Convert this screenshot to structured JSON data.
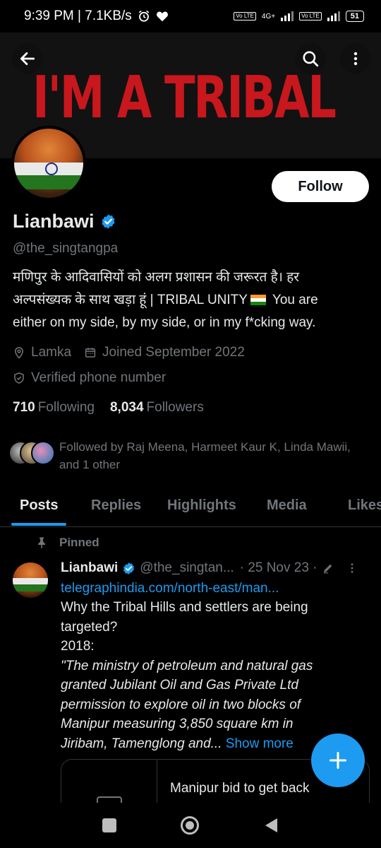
{
  "status_bar": {
    "time_speed": "9:39 PM | 7.1KB/s",
    "network_label": "4G+",
    "volte_label": "Vo LTE",
    "battery": "51"
  },
  "banner": {
    "text": "I'M A TRIBAL"
  },
  "profile": {
    "follow_label": "Follow",
    "display_name": "Lianbawi",
    "handle": "@the_singtangpa",
    "bio_line1": "मणिपुर के आदिवासियों को अलग प्रशासन की जरूरत है। हर",
    "bio_line2_pre": "अल्पसंख्यक के साथ खड़ा हूं | TRIBAL UNITY",
    "bio_line2_post": "You are",
    "bio_line3": "either on my side, by my side, or in my f*cking way.",
    "location": "Lamka",
    "joined": "Joined September 2022",
    "verified_phone": "Verified phone number",
    "following_count": "710",
    "following_label": "Following",
    "followers_count": "8,034",
    "followers_label": "Followers",
    "followed_by_line1": "Followed by Raj Meena, Harmeet Kaur K, Linda Mawii,",
    "followed_by_line2": "and 1 other"
  },
  "tabs": [
    "Posts",
    "Replies",
    "Highlights",
    "Media",
    "Likes"
  ],
  "active_tab": "Posts",
  "pinned_post": {
    "pinned_label": "Pinned",
    "author": "Lianbawi",
    "handle": "@the_singtan...",
    "date": "· 25 Nov 23 ·",
    "link": "telegraphindia.com/north-east/man...",
    "body_line1": "Why the Tribal Hills and settlers are being",
    "body_line2": "targeted?",
    "body_line3": "2018:",
    "quote_line1": "\"The ministry of petroleum and natural gas",
    "quote_line2": "granted Jubilant Oil and Gas Private Ltd",
    "quote_line3": "permission to explore oil in two blocks of",
    "quote_line4": "Manipur measuring 3,850 square km in",
    "quote_line5": "Jiribam, Tamenglong and...",
    "show_more": "Show more",
    "card_title": "Manipur bid to get back"
  },
  "colors": {
    "accent": "#1d9bf0",
    "banner_red": "#c8171d",
    "muted": "#71767b"
  }
}
